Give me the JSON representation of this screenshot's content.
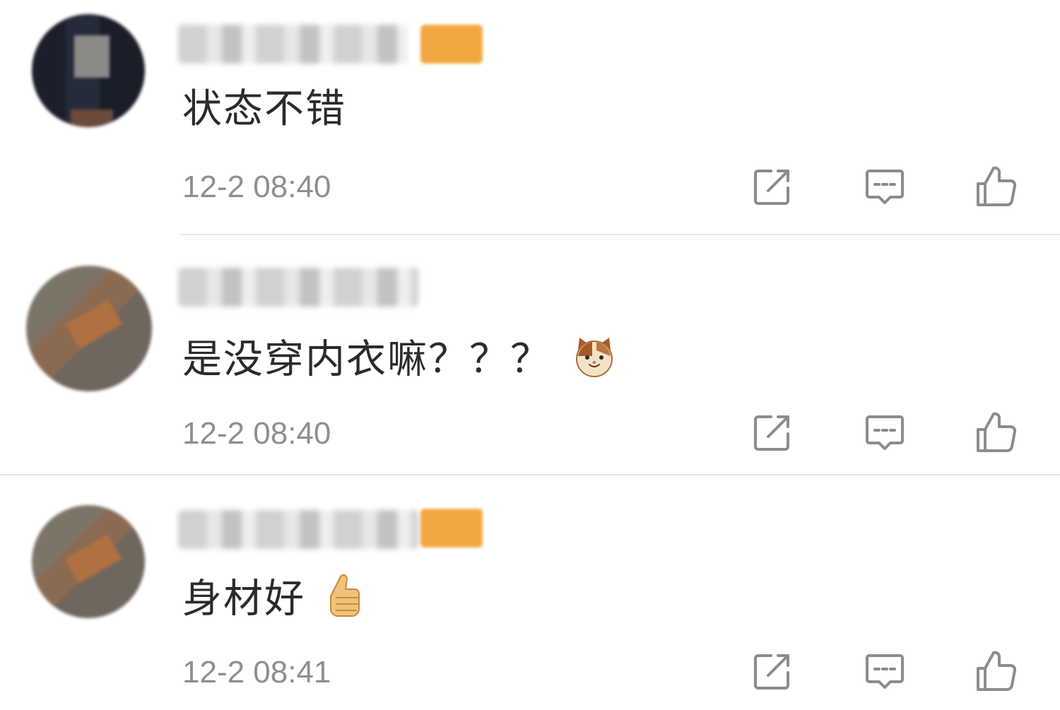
{
  "comments": [
    {
      "text": "状态不错",
      "time": "12-2 08:40",
      "has_badge": true,
      "avatar_style": "dark"
    },
    {
      "text": "是没穿内衣嘛？？？",
      "emoji": "cat-face-emoji",
      "time": "12-2 08:40",
      "has_badge": false,
      "avatar_style": "warm"
    },
    {
      "text": "身材好",
      "emoji": "thumbs-up-emoji",
      "time": "12-2 08:41",
      "has_badge": true,
      "avatar_style": "warm"
    }
  ],
  "actions": [
    "share-icon",
    "reply-icon",
    "like-icon"
  ],
  "colors": {
    "text": "#2b2b2b",
    "time": "#8f8f8f",
    "icon": "#8c8c8c",
    "badge": "#f2a842",
    "divider": "#e8e8e8"
  }
}
